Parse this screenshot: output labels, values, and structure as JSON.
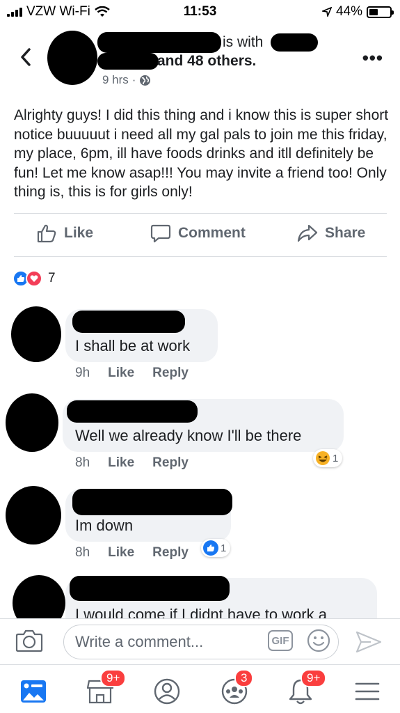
{
  "status_bar": {
    "carrier": "VZW Wi-Fi",
    "time": "11:53",
    "battery": "44%",
    "battery_level": 0.44
  },
  "post": {
    "is_with_text": "is with",
    "others_text": "and 48 others.",
    "time": "9 hrs",
    "privacy_separator": "·",
    "body": "Alrighty guys! I did this thing and i know this is super short notice buuuuut i need all my gal pals to join me this friday, my place, 6pm, ill have foods drinks and itll definitely be fun! Let me know asap!!! You may invite a friend too! Only thing is, this is for girls only!",
    "actions": {
      "like": "Like",
      "comment": "Comment",
      "share": "Share"
    },
    "reaction_count": "7"
  },
  "comments": [
    {
      "text": "I shall be at work",
      "time": "9h",
      "like": "Like",
      "reply": "Reply"
    },
    {
      "text": "Well we already know I'll be there",
      "time": "8h",
      "like": "Like",
      "reply": "Reply",
      "reaction": "haha",
      "reaction_count": "1"
    },
    {
      "text": "Im down",
      "time": "8h",
      "like": "Like",
      "reply": "Reply",
      "reaction": "like",
      "reaction_count": "1"
    },
    {
      "text": "I would come if I didnt have to work a"
    }
  ],
  "composer": {
    "placeholder": "Write a comment...",
    "gif": "GIF"
  },
  "tab_bar": {
    "badges": {
      "marketplace": "9+",
      "groups": "3",
      "notifications": "9+"
    }
  },
  "colors": {
    "brand_blue": "#1877f2",
    "love_red": "#f33e58",
    "badge_red": "#fa3e3e",
    "haha_yellow": "#f7b125"
  }
}
